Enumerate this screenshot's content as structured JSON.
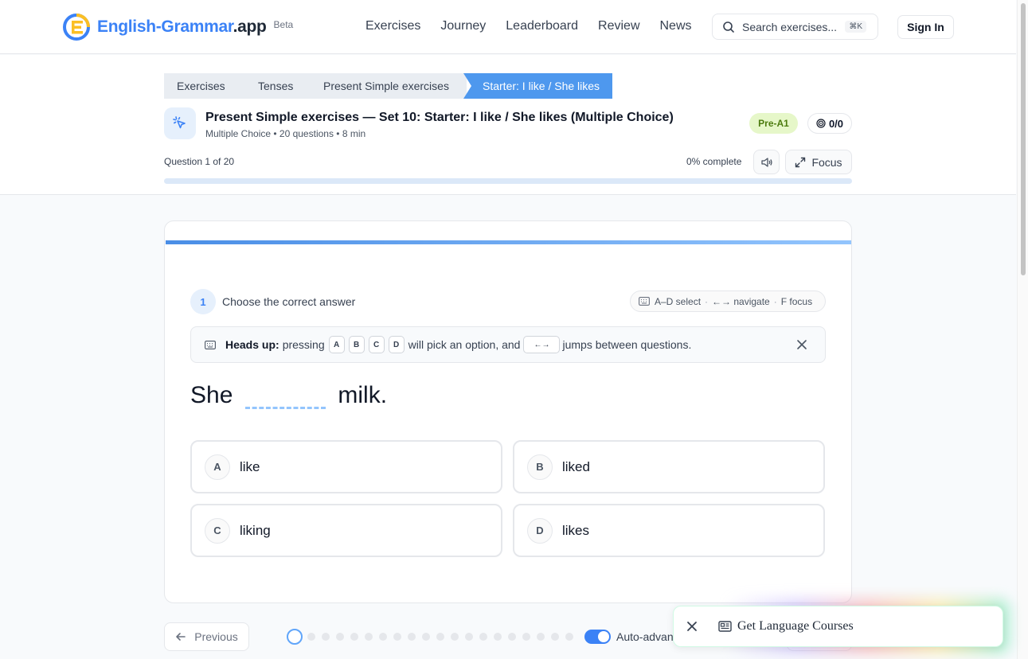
{
  "brand": {
    "name_main": "English-Grammar",
    "name_suffix": ".app",
    "badge": "Beta",
    "colors": {
      "accent": "#3b82f6",
      "logo_yellow": "#fbbf24"
    }
  },
  "nav": {
    "items": [
      "Exercises",
      "Journey",
      "Leaderboard",
      "Review",
      "News"
    ]
  },
  "search": {
    "placeholder": "Search exercises...",
    "shortcut": "⌘K",
    "icon": "search-icon"
  },
  "auth": {
    "sign_in": "Sign In"
  },
  "breadcrumb": [
    "Exercises",
    "Tenses",
    "Present Simple exercises",
    "Starter: I like / She likes"
  ],
  "exercise": {
    "title": "Present Simple exercises — Set 10: Starter: I like / She likes (Multiple Choice)",
    "meta": "Multiple Choice • 20 questions • 8 min",
    "level": "Pre-A1",
    "score": "0/0",
    "question_progress": "Question 1 of 20",
    "percent_label": "0% complete",
    "percent_value": 0,
    "focus_label": "Focus"
  },
  "question": {
    "number": "1",
    "prompt": "Choose the correct answer",
    "hints": {
      "select": "A–D select",
      "navigate": "←→ navigate",
      "focus": "F focus"
    },
    "headsup": {
      "label": "Heads up:",
      "pre": "pressing",
      "keys": [
        "A",
        "B",
        "C",
        "D"
      ],
      "mid": "will pick an option, and",
      "arrows": "←→",
      "post": "jumps between questions."
    },
    "sentence_before": "She",
    "sentence_after": "milk.",
    "options": [
      {
        "letter": "A",
        "text": "like"
      },
      {
        "letter": "B",
        "text": "liked"
      },
      {
        "letter": "C",
        "text": "liking"
      },
      {
        "letter": "D",
        "text": "likes"
      }
    ]
  },
  "footer": {
    "previous": "Previous",
    "total_questions": 20,
    "current_question": 1,
    "auto_advance": "Auto-advance",
    "auto_advance_on": true
  },
  "promo": {
    "text": "Get Language Courses"
  }
}
